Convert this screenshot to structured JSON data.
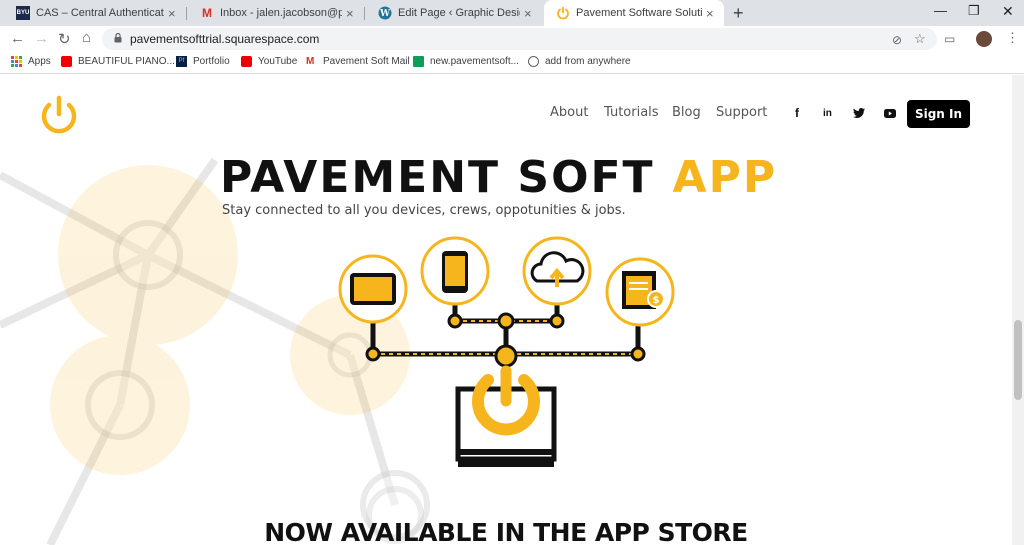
{
  "tabs": [
    {
      "title": "CAS – Central Authentication Se",
      "favicon": "byu-icon"
    },
    {
      "title": "Inbox - jalen.jacobson@paveme",
      "favicon": "gmail-icon"
    },
    {
      "title": "Edit Page ‹ Graphic Design Intern",
      "favicon": "wordpress-icon"
    },
    {
      "title": "Pavement Software Solutions",
      "favicon": "power-icon",
      "active": true
    }
  ],
  "address": {
    "url": "pavementsofttrial.squarespace.com"
  },
  "bookmarks": [
    {
      "label": "Apps"
    },
    {
      "label": "BEAUTIFUL PIANO..."
    },
    {
      "label": "Portfolio"
    },
    {
      "label": "YouTube"
    },
    {
      "label": "Pavement Soft Mail"
    },
    {
      "label": "new.pavementsoft..."
    },
    {
      "label": "add from anywhere"
    }
  ],
  "site": {
    "nav": [
      "About",
      "Tutorials",
      "Blog",
      "Support"
    ],
    "social": [
      "f",
      "in",
      "twitter-icon",
      "youtube-icon"
    ],
    "signin_label": "Sign In",
    "brand_color": "#f6b51c"
  },
  "hero": {
    "title_main": "PAVEMENT SOFT",
    "title_accent": "APP",
    "tagline": "Stay connected to all you devices, crews, oppotunities & jobs."
  },
  "store_heading": "NOW AVAILABLE IN THE APP STORE"
}
